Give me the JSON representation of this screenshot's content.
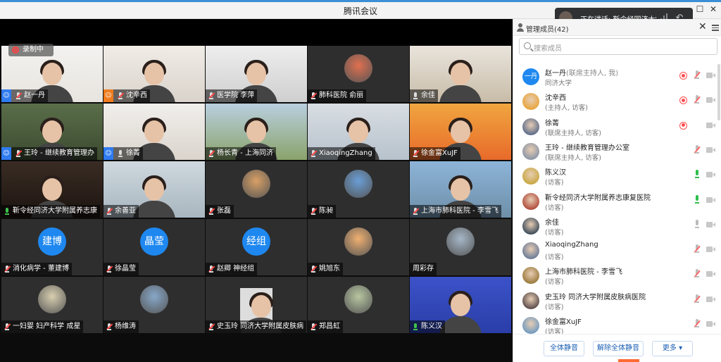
{
  "window": {
    "title": "腾讯会议"
  },
  "speaking": {
    "text": "正在讲话: 靳令经同济大学..."
  },
  "recording": {
    "label": "录制中"
  },
  "tiles": [
    {
      "label": "赵一丹",
      "host": "blue",
      "mic": "muted"
    },
    {
      "label": "沈辛西",
      "host": "orange",
      "mic": "muted"
    },
    {
      "label": "医学院 李萍",
      "host": "",
      "mic": "muted"
    },
    {
      "label": "肺科医院 俞丽",
      "host": "",
      "mic": "muted"
    },
    {
      "label": "余佳",
      "host": "",
      "mic": "normal"
    },
    {
      "label": "王玲 - 继续教育管理办",
      "host": "blue",
      "mic": "muted"
    },
    {
      "label": "徐菁",
      "host": "blue",
      "mic": "normal"
    },
    {
      "label": "杨长青 - 上海同济",
      "host": "",
      "mic": "muted"
    },
    {
      "label": "XiaoqingZhang",
      "host": "",
      "mic": "muted"
    },
    {
      "label": "徐金富XuJF",
      "host": "",
      "mic": "muted"
    },
    {
      "label": "靳令经同济大学附属养志康",
      "host": "",
      "mic": "green"
    },
    {
      "label": "余善亚",
      "host": "",
      "mic": "muted"
    },
    {
      "label": "张磊",
      "host": "",
      "mic": "muted"
    },
    {
      "label": "陈昶",
      "host": "",
      "mic": "muted"
    },
    {
      "label": "上海市肺科医院 - 李雪飞",
      "host": "",
      "mic": "muted"
    },
    {
      "label": "消化病学 - 董建博",
      "host": "",
      "mic": "muted",
      "avatar_text": "建博"
    },
    {
      "label": "徐晶莹",
      "host": "",
      "mic": "muted",
      "avatar_text": "晶莹"
    },
    {
      "label": "赵卿 神经组",
      "host": "",
      "mic": "muted",
      "avatar_text": "经组"
    },
    {
      "label": "姚旭东",
      "host": "",
      "mic": "muted"
    },
    {
      "label": "周彩存",
      "host": "",
      "mic": "none"
    },
    {
      "label": "一妇婴 妇产科学 成星",
      "host": "",
      "mic": "muted"
    },
    {
      "label": "杨维涛",
      "host": "",
      "mic": "muted"
    },
    {
      "label": "史玉玲 同济大学附属皮肤病",
      "host": "",
      "mic": "muted"
    },
    {
      "label": "郑昌虹",
      "host": "",
      "mic": "muted"
    },
    {
      "label": "陈义汉",
      "host": "",
      "mic": "green"
    }
  ],
  "panel": {
    "title": "管理成员(42)",
    "search_placeholder": "搜索成员",
    "members": [
      {
        "name": "赵一丹",
        "name_suffix": "(联席主持人, 我)",
        "role": "同济大学",
        "avatar_text": "一丹",
        "rec": true,
        "mic": "muted"
      },
      {
        "name": "沈辛西",
        "name_suffix": "",
        "role": "(主持人, 访客)",
        "avatar_text": "",
        "rec": true,
        "mic": "muted"
      },
      {
        "name": "徐菁",
        "name_suffix": "",
        "role": "(联席主持人, 访客)",
        "avatar_text": "",
        "rec": true,
        "mic": "none"
      },
      {
        "name": "王玲 - 继续教育管理办公室",
        "name_suffix": "",
        "role": "(联席主持人, 访客)",
        "avatar_text": "",
        "rec": false,
        "mic": "muted"
      },
      {
        "name": "陈义汉",
        "name_suffix": "",
        "role": "(访客)",
        "avatar_text": "",
        "rec": false,
        "mic": "green"
      },
      {
        "name": "靳令经同济大学附属养志康复医院",
        "name_suffix": "",
        "role": "(访客)",
        "avatar_text": "",
        "rec": false,
        "mic": "green"
      },
      {
        "name": "余佳",
        "name_suffix": "",
        "role": "(访客)",
        "avatar_text": "",
        "rec": false,
        "mic": "normal"
      },
      {
        "name": "XiaoqingZhang",
        "name_suffix": "",
        "role": "(访客)",
        "avatar_text": "",
        "rec": false,
        "mic": "muted"
      },
      {
        "name": "上海市肺科医院 - 李雪飞",
        "name_suffix": "",
        "role": "(访客)",
        "avatar_text": "",
        "rec": false,
        "mic": "muted"
      },
      {
        "name": "史玉玲 同济大学附属皮肤病医院",
        "name_suffix": "",
        "role": "(访客)",
        "avatar_text": "",
        "rec": false,
        "mic": "muted"
      },
      {
        "name": "徐金富XuJF",
        "name_suffix": "",
        "role": "(访客)",
        "avatar_text": "",
        "rec": false,
        "mic": "muted"
      }
    ],
    "buttons": {
      "mute_all": "全体静音",
      "unmute_all": "解除全体静音",
      "more": "更多 ▾"
    }
  },
  "colors": {
    "accent": "#1e88f0",
    "host_orange": "#f07c1e",
    "recording_red": "#ff4d4f",
    "speaking_green": "#2fbf4a"
  }
}
